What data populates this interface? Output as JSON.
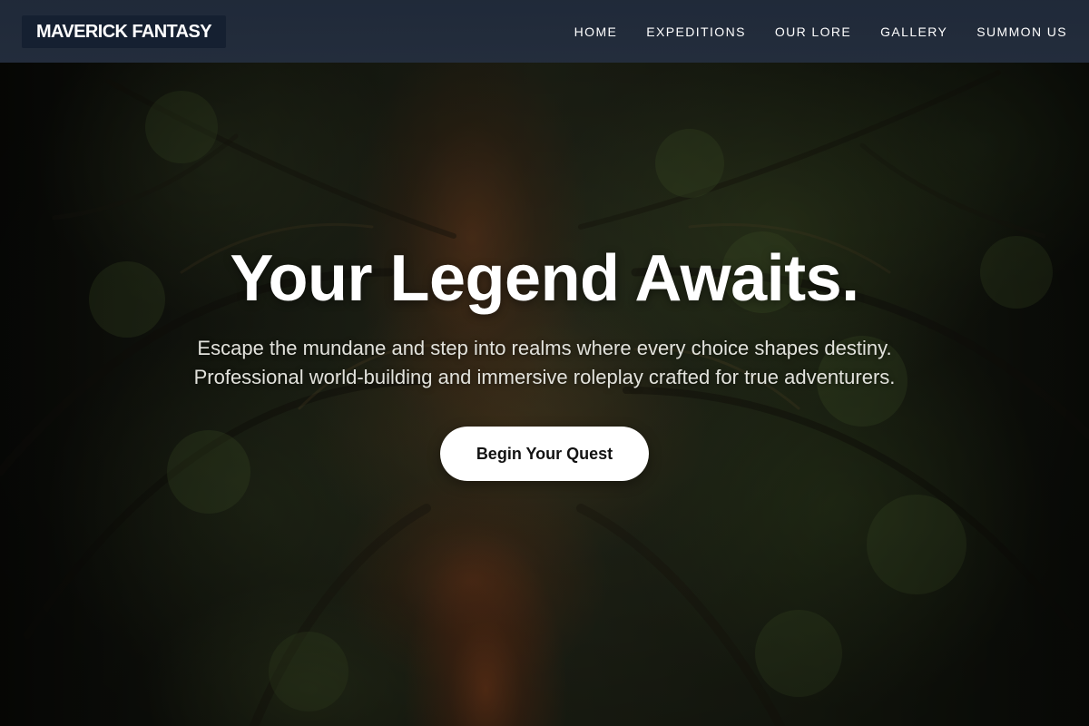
{
  "header": {
    "logo": "MAVERICK FANTASY",
    "nav": [
      {
        "label": "HOME"
      },
      {
        "label": "EXPEDITIONS"
      },
      {
        "label": "OUR LORE"
      },
      {
        "label": "GALLERY"
      },
      {
        "label": "SUMMON US"
      }
    ]
  },
  "hero": {
    "title": "Your Legend Awaits.",
    "subtitle_lines": [
      "Escape the mundane and step into realms where every choice shapes destiny.",
      "Professional world-building and immersive roleplay crafted for true adventurers."
    ],
    "cta_label": "Begin Your Quest",
    "background": "forest-tunnel-image"
  },
  "colors": {
    "header_bg": "#222c3c",
    "logo_bg": "#152031",
    "text": "#ffffff",
    "cta_bg": "#ffffff",
    "cta_text": "#121212"
  }
}
